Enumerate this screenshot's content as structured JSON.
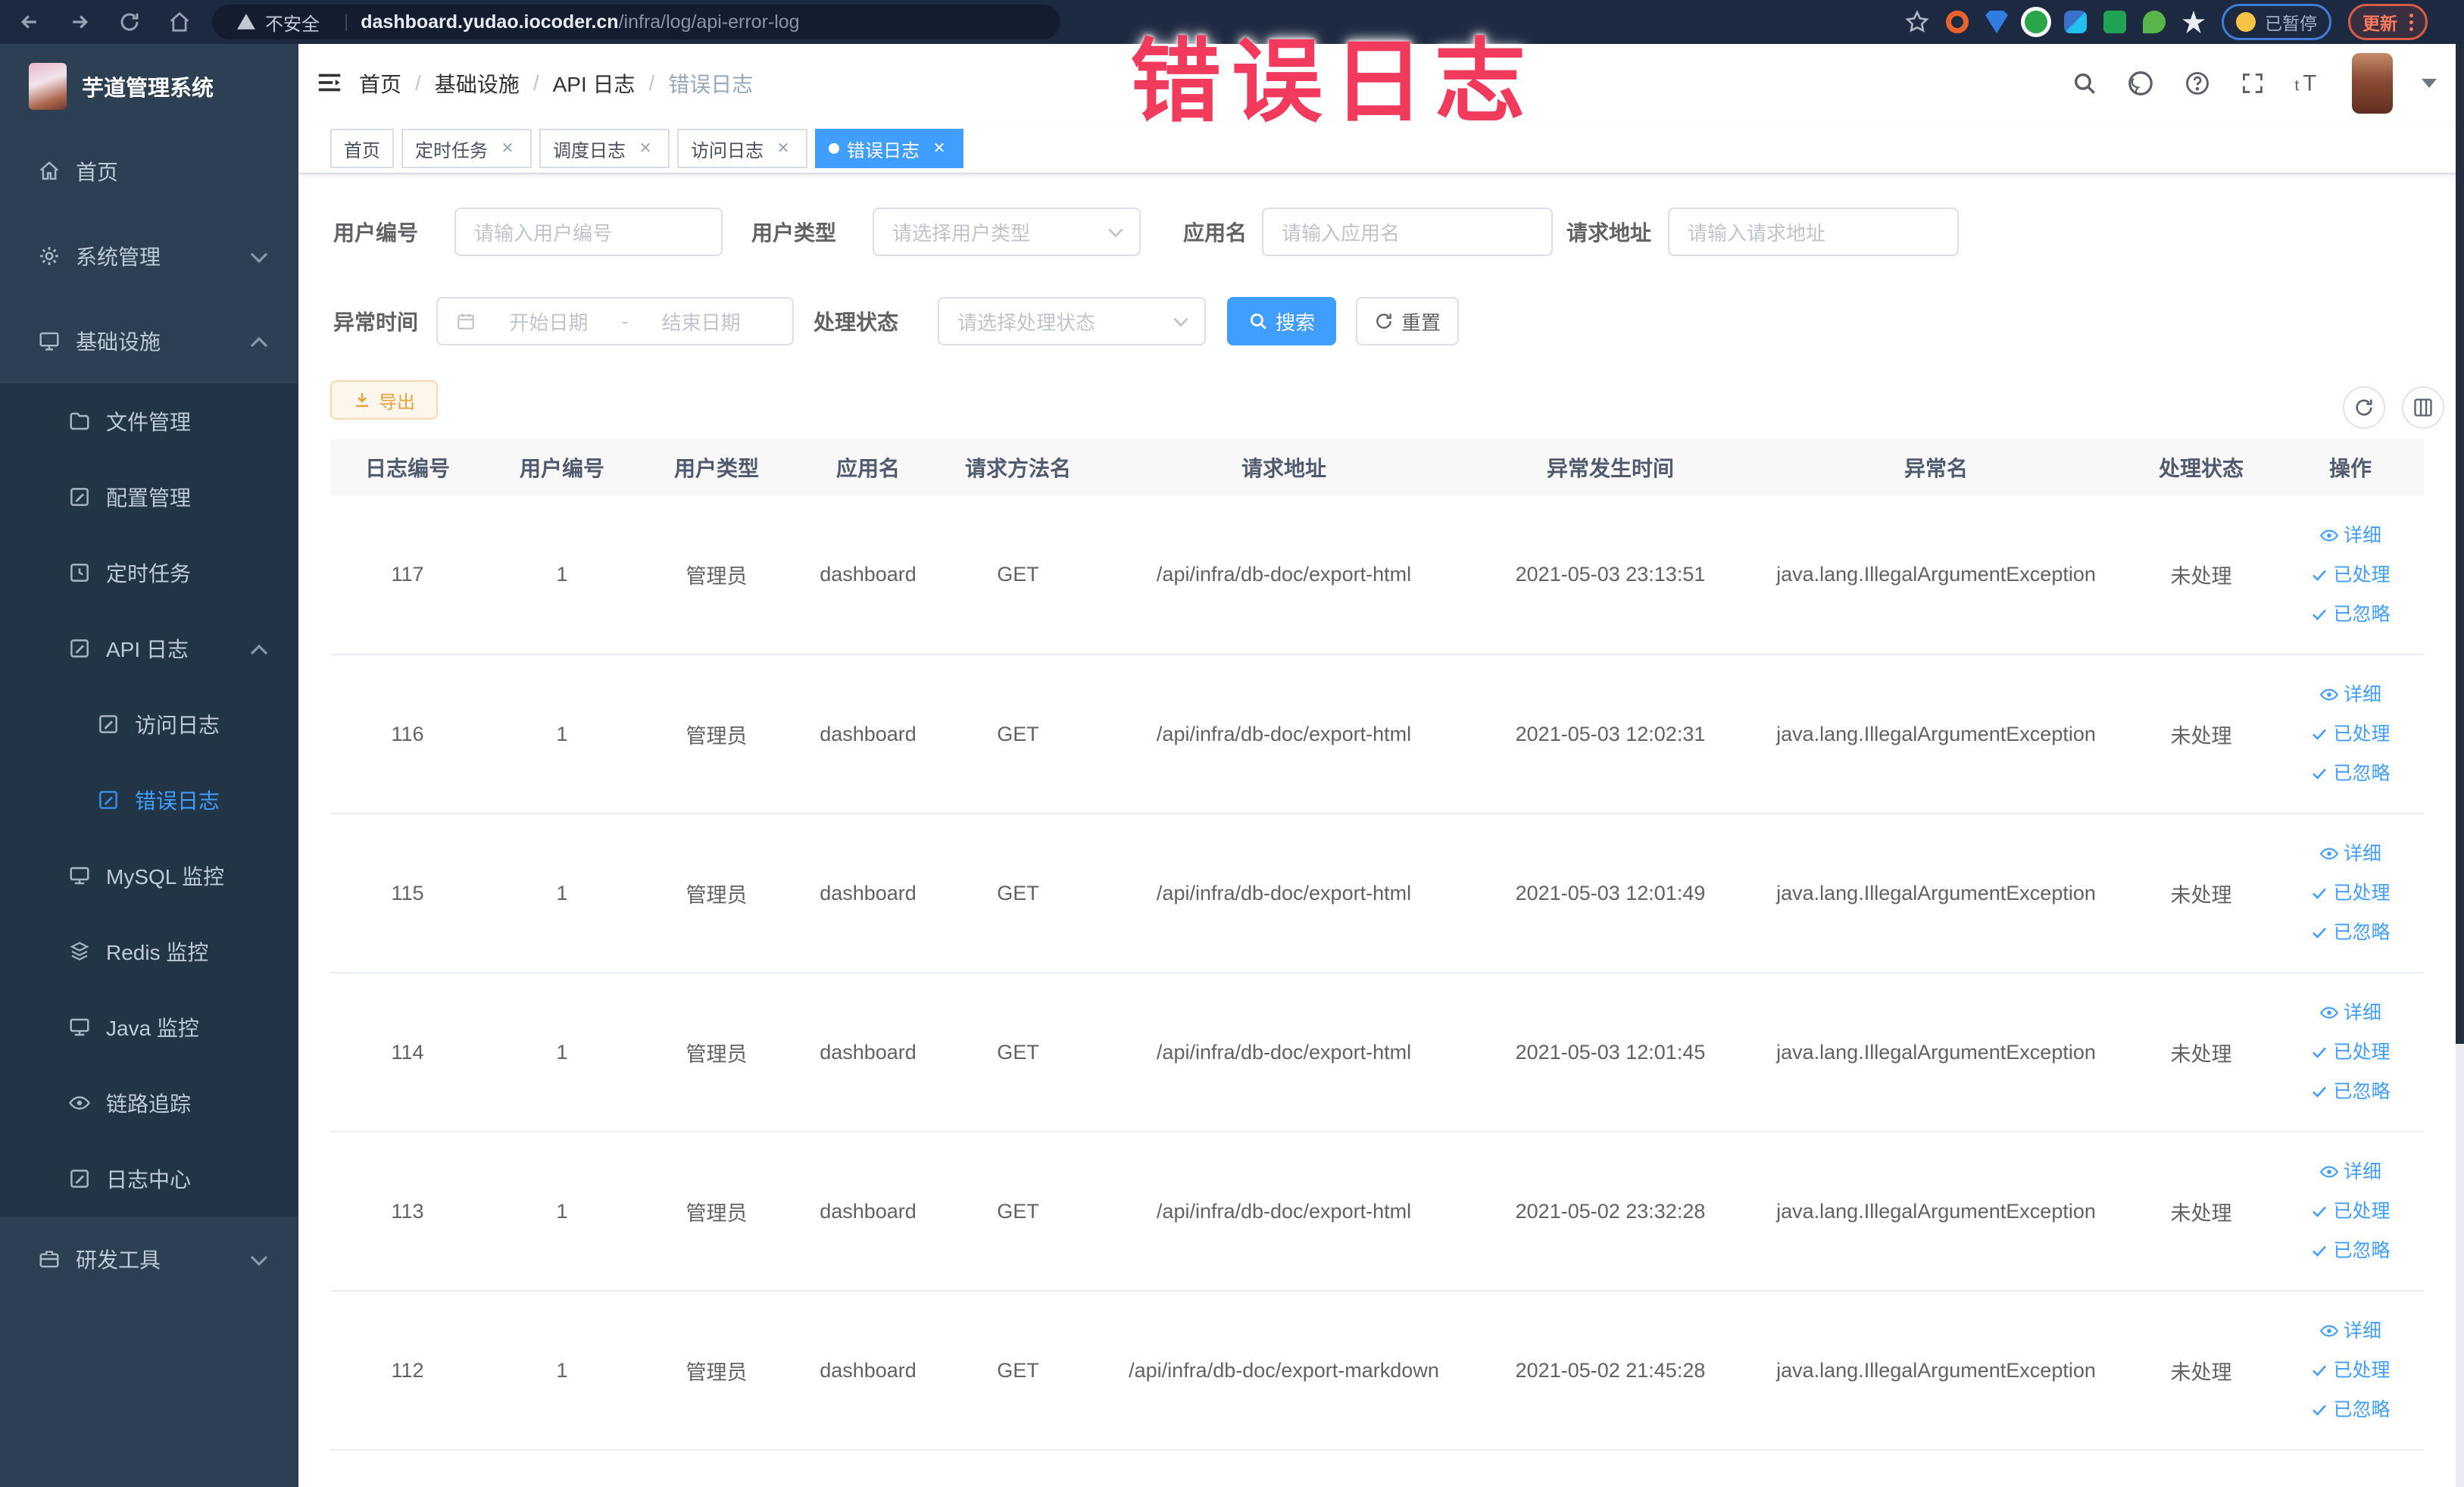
{
  "browser": {
    "security_label": "不安全",
    "url_host": "dashboard.yudao.iocoder.cn",
    "url_path": "/infra/log/api-error-log",
    "paused_label": "已暂停",
    "update_label": "更新"
  },
  "annotation": {
    "text": "错误日志",
    "color": "#f23a5c"
  },
  "sidebar": {
    "logo_title": "芋道管理系统",
    "menu": [
      {
        "label": "首页",
        "icon": "home-icon",
        "level": 1
      },
      {
        "label": "系统管理",
        "icon": "gear-icon",
        "level": 1,
        "arrow": "down"
      },
      {
        "label": "基础设施",
        "icon": "infra-icon",
        "level": 1,
        "arrow": "up"
      },
      {
        "label": "文件管理",
        "icon": "file-icon",
        "level": 2
      },
      {
        "label": "配置管理",
        "icon": "config-icon",
        "level": 2
      },
      {
        "label": "定时任务",
        "icon": "job-icon",
        "level": 2
      },
      {
        "label": "API 日志",
        "icon": "api-log-icon",
        "level": 2,
        "arrow": "up"
      },
      {
        "label": "访问日志",
        "icon": "access-log-icon",
        "level": 3
      },
      {
        "label": "错误日志",
        "icon": "error-log-icon",
        "level": 3,
        "active": true
      },
      {
        "label": "MySQL 监控",
        "icon": "mysql-icon",
        "level": 2
      },
      {
        "label": "Redis 监控",
        "icon": "redis-icon",
        "level": 2
      },
      {
        "label": "Java 监控",
        "icon": "java-icon",
        "level": 2
      },
      {
        "label": "链路追踪",
        "icon": "trace-icon",
        "level": 2
      },
      {
        "label": "日志中心",
        "icon": "log-center-icon",
        "level": 2
      },
      {
        "label": "研发工具",
        "icon": "tools-icon",
        "level": 1,
        "arrow": "down"
      }
    ]
  },
  "header": {
    "breadcrumb": [
      "首页",
      "基础设施",
      "API 日志",
      "错误日志"
    ]
  },
  "tabs": [
    {
      "label": "首页",
      "closable": false,
      "active": false
    },
    {
      "label": "定时任务",
      "closable": true,
      "active": false
    },
    {
      "label": "调度日志",
      "closable": true,
      "active": false
    },
    {
      "label": "访问日志",
      "closable": true,
      "active": false
    },
    {
      "label": "错误日志",
      "closable": true,
      "active": true
    }
  ],
  "filters": {
    "user_id": {
      "label": "用户编号",
      "placeholder": "请输入用户编号"
    },
    "user_type": {
      "label": "用户类型",
      "placeholder": "请选择用户类型"
    },
    "app_name": {
      "label": "应用名",
      "placeholder": "请输入应用名"
    },
    "request_url": {
      "label": "请求地址",
      "placeholder": "请输入请求地址"
    },
    "exception_time": {
      "label": "异常时间",
      "start_placeholder": "开始日期",
      "separator": "-",
      "end_placeholder": "结束日期"
    },
    "process_status": {
      "label": "处理状态",
      "placeholder": "请选择处理状态"
    },
    "search_label": "搜索",
    "reset_label": "重置"
  },
  "toolbar": {
    "export_label": "导出"
  },
  "table": {
    "columns": [
      "日志编号",
      "用户编号",
      "用户类型",
      "应用名",
      "请求方法名",
      "请求地址",
      "异常发生时间",
      "异常名",
      "处理状态",
      "操作"
    ],
    "action_labels": [
      "详细",
      "已处理",
      "已忽略"
    ],
    "rows": [
      {
        "id": "117",
        "user_id": "1",
        "user_type": "管理员",
        "app": "dashboard",
        "method": "GET",
        "url": "/api/infra/db-doc/export-html",
        "time": "2021-05-03 23:13:51",
        "exception": "java.lang.IllegalArgumentException",
        "status": "未处理"
      },
      {
        "id": "116",
        "user_id": "1",
        "user_type": "管理员",
        "app": "dashboard",
        "method": "GET",
        "url": "/api/infra/db-doc/export-html",
        "time": "2021-05-03 12:02:31",
        "exception": "java.lang.IllegalArgumentException",
        "status": "未处理"
      },
      {
        "id": "115",
        "user_id": "1",
        "user_type": "管理员",
        "app": "dashboard",
        "method": "GET",
        "url": "/api/infra/db-doc/export-html",
        "time": "2021-05-03 12:01:49",
        "exception": "java.lang.IllegalArgumentException",
        "status": "未处理"
      },
      {
        "id": "114",
        "user_id": "1",
        "user_type": "管理员",
        "app": "dashboard",
        "method": "GET",
        "url": "/api/infra/db-doc/export-html",
        "time": "2021-05-03 12:01:45",
        "exception": "java.lang.IllegalArgumentException",
        "status": "未处理"
      },
      {
        "id": "113",
        "user_id": "1",
        "user_type": "管理员",
        "app": "dashboard",
        "method": "GET",
        "url": "/api/infra/db-doc/export-html",
        "time": "2021-05-02 23:32:28",
        "exception": "java.lang.IllegalArgumentException",
        "status": "未处理"
      },
      {
        "id": "112",
        "user_id": "1",
        "user_type": "管理员",
        "app": "dashboard",
        "method": "GET",
        "url": "/api/infra/db-doc/export-markdown",
        "time": "2021-05-02 21:45:28",
        "exception": "java.lang.IllegalArgumentException",
        "status": "未处理"
      }
    ]
  },
  "colors": {
    "accent": "#409eff",
    "warning": "#e6a23c",
    "annotation": "#f23a5c",
    "sidebar_bg": "#2d3f53",
    "submenu_bg": "#223547"
  }
}
